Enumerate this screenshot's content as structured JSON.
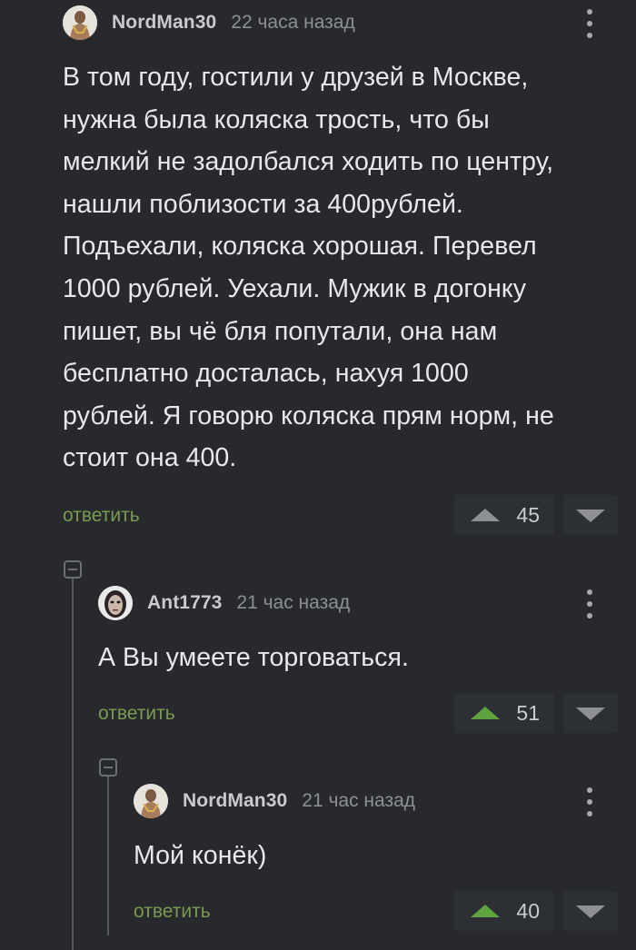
{
  "comments": [
    {
      "username": "NordMan30",
      "time": "22 часа назад",
      "text": "В том году, гостили у друзей в Москве,\nнужна была коляска трость, что бы\nмелкий не задолбался ходить по центру,\nнашли поблизости за 400рублей.\nПодъехали, коляска хорошая. Перевел\n1000 рублей. Уехали. Мужик в догонку\nпишет, вы чё бля попутали, она нам\nбесплатно досталась, нахуя 1000\nрублей. Я говорю коляска прям норм, не\nстоит она 400.",
      "reply_label": "ответить",
      "rating": "45",
      "upvoted": false
    },
    {
      "username": "Ant1773",
      "time": "21 час назад",
      "text": "А Вы умеете торговаться.",
      "reply_label": "ответить",
      "rating": "51",
      "upvoted": true
    },
    {
      "username": "NordMan30",
      "time": "21 час назад",
      "text": "Мой конёк)",
      "reply_label": "ответить",
      "rating": "40",
      "upvoted": true
    }
  ],
  "icons": {
    "more": "more-vertical-icon",
    "upvote": "arrow-up-icon",
    "downvote": "arrow-down-icon",
    "collapse": "collapse-thread-icon"
  },
  "colors": {
    "background": "#27292d",
    "reply_link": "#7a9a52",
    "upvote_active": "#5fa33e",
    "upvote_inactive": "#8e9094"
  }
}
